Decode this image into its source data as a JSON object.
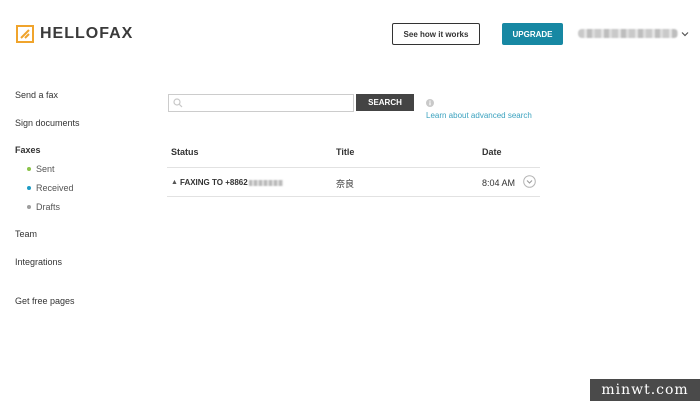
{
  "header": {
    "logo_text": "HELLOFAX",
    "how_it_works_label": "See how it works",
    "upgrade_label": "UPGRADE"
  },
  "sidebar": {
    "send_fax": "Send a fax",
    "sign_documents": "Sign documents",
    "faxes": "Faxes",
    "faxes_sub": [
      {
        "label": "Sent",
        "color": "#8bc34a"
      },
      {
        "label": "Received",
        "color": "#1e9bc4"
      },
      {
        "label": "Drafts",
        "color": "#9e9e9e"
      }
    ],
    "team": "Team",
    "integrations": "Integrations",
    "get_free_pages": "Get free pages"
  },
  "search": {
    "value": "",
    "placeholder": "",
    "button_label": "SEARCH",
    "advanced_link": "Learn about advanced search"
  },
  "table": {
    "columns": [
      "Status",
      "Title",
      "Date"
    ],
    "rows": [
      {
        "status": "FAXING TO +8862",
        "title": "奈良",
        "date": "8:04 AM"
      }
    ]
  },
  "watermark": "minwt.com",
  "colors": {
    "accent": "#1788a3",
    "link": "#3ba2bf",
    "logo": "#f0a42c"
  }
}
